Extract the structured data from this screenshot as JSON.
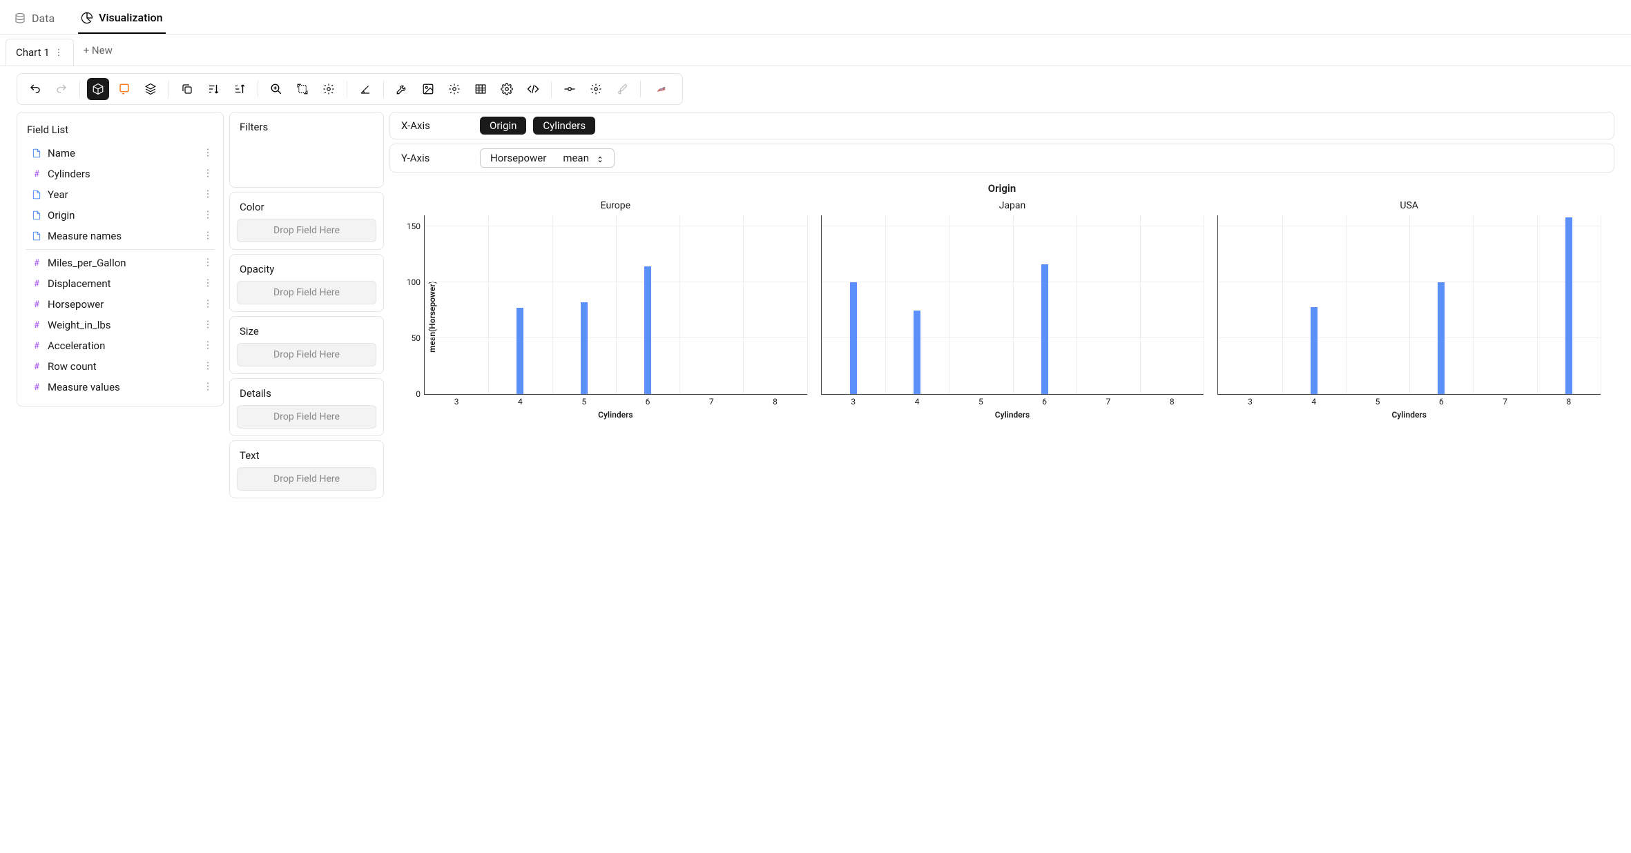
{
  "top_tabs": {
    "data": "Data",
    "visualization": "Visualization"
  },
  "chart_tabs": {
    "active": "Chart 1",
    "new_label": "+ New"
  },
  "field_list": {
    "title": "Field List",
    "dims": [
      {
        "name": "Name",
        "type": "text"
      },
      {
        "name": "Cylinders",
        "type": "num"
      },
      {
        "name": "Year",
        "type": "text"
      },
      {
        "name": "Origin",
        "type": "text"
      },
      {
        "name": "Measure names",
        "type": "text"
      }
    ],
    "measures": [
      {
        "name": "Miles_per_Gallon",
        "type": "num"
      },
      {
        "name": "Displacement",
        "type": "num"
      },
      {
        "name": "Horsepower",
        "type": "num"
      },
      {
        "name": "Weight_in_lbs",
        "type": "num"
      },
      {
        "name": "Acceleration",
        "type": "num"
      },
      {
        "name": "Row count",
        "type": "num"
      },
      {
        "name": "Measure values",
        "type": "num"
      }
    ]
  },
  "shelves": {
    "filters": "Filters",
    "color": "Color",
    "opacity": "Opacity",
    "size": "Size",
    "details": "Details",
    "text": "Text",
    "drop_placeholder": "Drop Field Here"
  },
  "axes": {
    "x_label": "X-Axis",
    "y_label": "Y-Axis",
    "x_pills": [
      "Origin",
      "Cylinders"
    ],
    "y_pill": {
      "field": "Horsepower",
      "agg": "mean"
    }
  },
  "chart_data": {
    "type": "bar",
    "title": "Origin",
    "ylabel": "mean(Horsepower)",
    "xlabel": "Cylinders",
    "ylim": [
      0,
      160
    ],
    "yticks": [
      0,
      50,
      100,
      150
    ],
    "categories": [
      3,
      4,
      5,
      6,
      7,
      8
    ],
    "facets": [
      {
        "name": "Europe",
        "values": {
          "4": 77,
          "5": 82,
          "6": 114
        }
      },
      {
        "name": "Japan",
        "values": {
          "3": 100,
          "4": 75,
          "6": 116
        }
      },
      {
        "name": "USA",
        "values": {
          "4": 78,
          "6": 100,
          "8": 158
        }
      }
    ],
    "bar_color": "#5b8ff9"
  }
}
